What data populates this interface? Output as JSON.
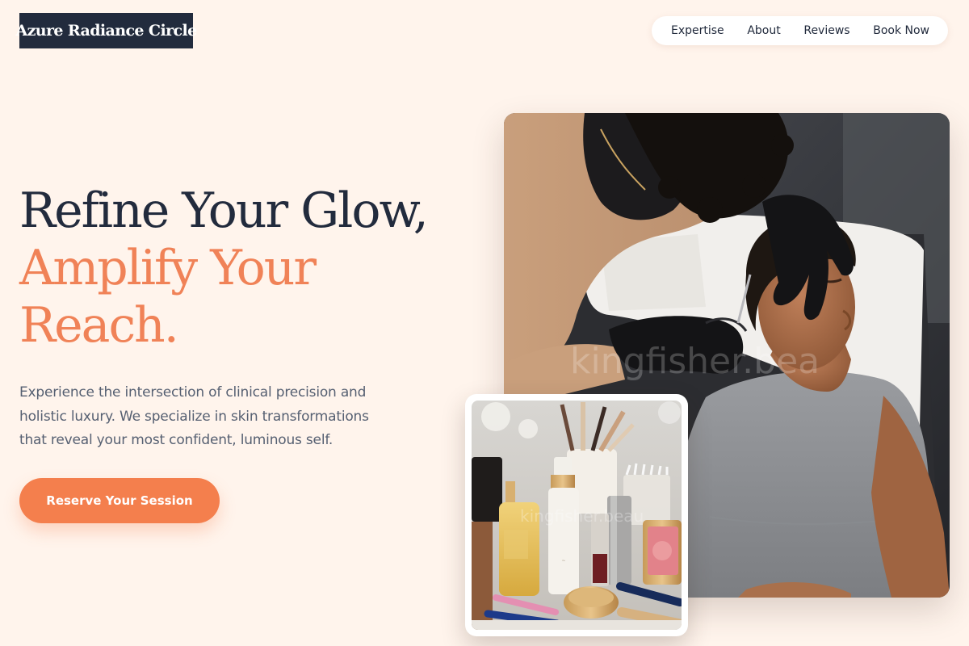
{
  "brand": {
    "logo_text": "Azure Radiance Circle"
  },
  "nav": {
    "items": [
      {
        "label": "Expertise"
      },
      {
        "label": "About"
      },
      {
        "label": "Reviews"
      },
      {
        "label": "Book Now"
      }
    ]
  },
  "hero": {
    "headline_line1": "Refine Your Glow,",
    "headline_line2": "Amplify Your",
    "headline_line3": "Reach.",
    "description": "Experience the intersection of clinical precision and holistic luxury. We specialize in skin transformations that reveal your most confident, luminous self.",
    "cta_label": "Reserve Your Session",
    "main_image_alt": "Esthetician in black gloves performing a facial treatment on a client",
    "main_image_watermark": "kingfisher.bea",
    "inset_image_alt": "Beauty products, serums and makeup brushes on a vanity",
    "inset_image_watermark": "kingfisher.beau"
  },
  "colors": {
    "page_background": "#fff4ec",
    "navy": "#222b3d",
    "accent": "#f08257",
    "button": "#f47f4d",
    "body_text": "#566072"
  }
}
